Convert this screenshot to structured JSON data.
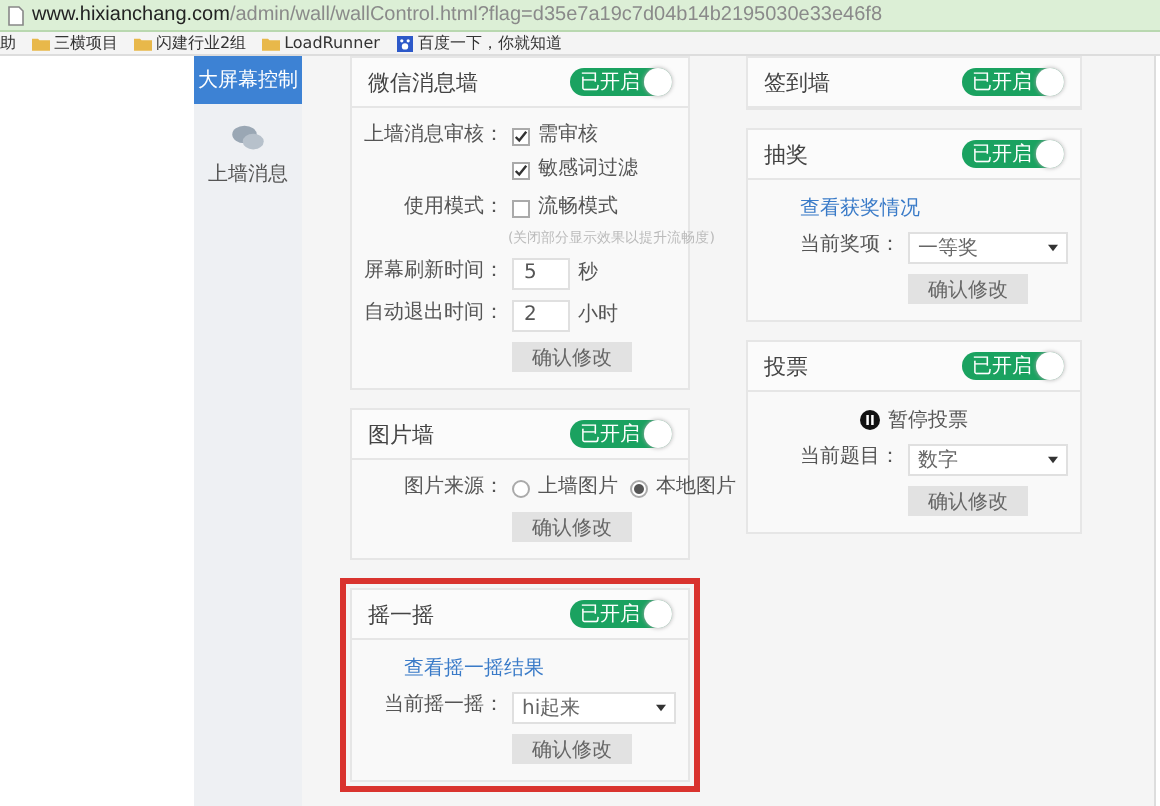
{
  "browser": {
    "url_host": "www.hixianchang.com",
    "url_path": "/admin/wall/wallControl.html?flag=d35e7a19c7d04b14b2195030e33e46f8"
  },
  "bookmarks": [
    {
      "label": "助",
      "kind": "plain"
    },
    {
      "label": "三横项目",
      "kind": "folder"
    },
    {
      "label": "闪建行业2组",
      "kind": "folder"
    },
    {
      "label": "LoadRunner",
      "kind": "folder"
    },
    {
      "label": "百度一下，你就知道",
      "kind": "site"
    }
  ],
  "sidebar": [
    {
      "label": "大屏幕控制",
      "selected": true,
      "kind": "plain"
    },
    {
      "label": "上墙消息",
      "selected": false,
      "kind": "chat"
    }
  ],
  "left_cards": [
    {
      "title": "微信消息墙",
      "toggle": {
        "label": "已开启",
        "on": true
      },
      "highlighted": false,
      "rows": [
        {
          "kind": "checks",
          "label": "上墙消息审核：",
          "options": [
            {
              "label": "需审核",
              "checked": true
            },
            {
              "label": "敏感词过滤",
              "checked": true
            }
          ]
        },
        {
          "kind": "checks",
          "label": "使用模式：",
          "options": [
            {
              "label": "流畅模式",
              "checked": false
            }
          ],
          "hint": "(关闭部分显示效果以提升流畅度)"
        },
        {
          "kind": "number",
          "label": "屏幕刷新时间：",
          "value": "5",
          "unit": "秒"
        },
        {
          "kind": "number",
          "label": "自动退出时间：",
          "value": "2",
          "unit": "小时"
        },
        {
          "kind": "button",
          "text": "确认修改"
        }
      ]
    },
    {
      "title": "图片墙",
      "toggle": {
        "label": "已开启",
        "on": true
      },
      "highlighted": false,
      "rows": [
        {
          "kind": "radios",
          "label": "图片来源：",
          "options": [
            {
              "label": "上墙图片",
              "selected": false
            },
            {
              "label": "本地图片",
              "selected": true
            }
          ]
        },
        {
          "kind": "button",
          "text": "确认修改"
        }
      ]
    },
    {
      "title": "摇一摇",
      "toggle": {
        "label": "已开启",
        "on": true
      },
      "highlighted": true,
      "rows": [
        {
          "kind": "link",
          "text": "查看摇一摇结果"
        },
        {
          "kind": "select",
          "label": "当前摇一摇：",
          "value": "hi起来"
        },
        {
          "kind": "button",
          "text": "确认修改"
        }
      ]
    }
  ],
  "right_cards": [
    {
      "title": "签到墙",
      "toggle": {
        "label": "已开启",
        "on": true
      },
      "highlighted": false
    },
    {
      "title": "抽奖",
      "toggle": {
        "label": "已开启",
        "on": true
      },
      "highlighted": false,
      "rows": [
        {
          "kind": "link",
          "text": "查看获奖情况"
        },
        {
          "kind": "select",
          "label": "当前奖项：",
          "value": "一等奖"
        },
        {
          "kind": "button",
          "text": "确认修改"
        }
      ]
    },
    {
      "title": "投票",
      "toggle": {
        "label": "已开启",
        "on": true
      },
      "highlighted": false,
      "rows": [
        {
          "kind": "pause",
          "text": "暂停投票"
        },
        {
          "kind": "select",
          "label": "当前题目：",
          "value": "数字"
        },
        {
          "kind": "button",
          "text": "确认修改"
        }
      ]
    }
  ]
}
